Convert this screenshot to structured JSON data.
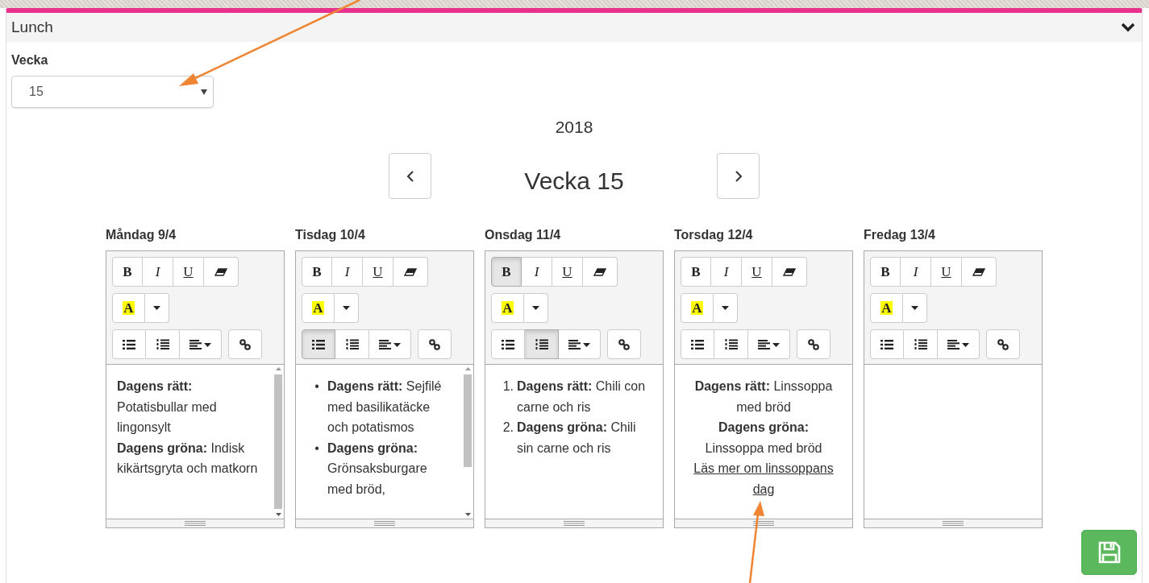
{
  "panel": {
    "title": "Lunch"
  },
  "week_field": {
    "label": "Vecka",
    "value": "15"
  },
  "year": "2018",
  "week_title": "Vecka 15",
  "days": [
    {
      "heading": "Måndag 9/4",
      "toolbar": {
        "bold": {
          "label": "B",
          "on": false
        },
        "italic": {
          "label": "I",
          "on": false
        },
        "underline": {
          "label": "U",
          "on": false
        },
        "highlight": {
          "label": "A"
        },
        "bullet_list": {
          "on": false
        },
        "numbered_list": {
          "on": false
        }
      },
      "scrollbar": true,
      "content": {
        "kind": "plain",
        "items": [
          {
            "text": "**Dagens rätt:** Potatisbullar med lingonsylt"
          },
          {
            "text": "**Dagens gröna:** Indisk kikärtsgryta och matkorn"
          }
        ]
      }
    },
    {
      "heading": "Tisdag 10/4",
      "toolbar": {
        "bold": {
          "label": "B",
          "on": false
        },
        "italic": {
          "label": "I",
          "on": false
        },
        "underline": {
          "label": "U",
          "on": false
        },
        "highlight": {
          "label": "A"
        },
        "bullet_list": {
          "on": true
        },
        "numbered_list": {
          "on": false
        }
      },
      "scrollbar": true,
      "content": {
        "kind": "bullets",
        "items": [
          {
            "marker": "•",
            "text": "**Dagens rätt:** Sejfilé med basilikatäcke och potatismos"
          },
          {
            "marker": "•",
            "text": "**Dagens gröna:** Grönsaksburgare med bröd,"
          }
        ]
      }
    },
    {
      "heading": "Onsdag 11/4",
      "toolbar": {
        "bold": {
          "label": "B",
          "on": true
        },
        "italic": {
          "label": "I",
          "on": false
        },
        "underline": {
          "label": "U",
          "on": false
        },
        "highlight": {
          "label": "A"
        },
        "bullet_list": {
          "on": false
        },
        "numbered_list": {
          "on": true
        }
      },
      "scrollbar": false,
      "content": {
        "kind": "numbered",
        "items": [
          {
            "marker": "1.",
            "text": "**Dagens rätt:** Chili con carne och ris"
          },
          {
            "marker": "2.",
            "text": "**Dagens gröna:** Chili sin carne och ris"
          }
        ]
      }
    },
    {
      "heading": "Torsdag 12/4",
      "toolbar": {
        "bold": {
          "label": "B",
          "on": false
        },
        "italic": {
          "label": "I",
          "on": false
        },
        "underline": {
          "label": "U",
          "on": false
        },
        "highlight": {
          "label": "A"
        },
        "bullet_list": {
          "on": false
        },
        "numbered_list": {
          "on": false
        }
      },
      "scrollbar": false,
      "content": {
        "kind": "centered",
        "items": [
          {
            "text": "**Dagens rätt:** Linssoppa med bröd"
          },
          {
            "text": "**Dagens gröna:**"
          },
          {
            "text": "Linssoppa med bröd"
          },
          {
            "kind": "link",
            "text": "Läs mer om linssoppans dag"
          }
        ]
      }
    },
    {
      "heading": "Fredag 13/4",
      "toolbar": {
        "bold": {
          "label": "B",
          "on": false
        },
        "italic": {
          "label": "I",
          "on": false
        },
        "underline": {
          "label": "U",
          "on": false
        },
        "highlight": {
          "label": "A"
        },
        "bullet_list": {
          "on": false
        },
        "numbered_list": {
          "on": false
        }
      },
      "scrollbar": false
    }
  ]
}
